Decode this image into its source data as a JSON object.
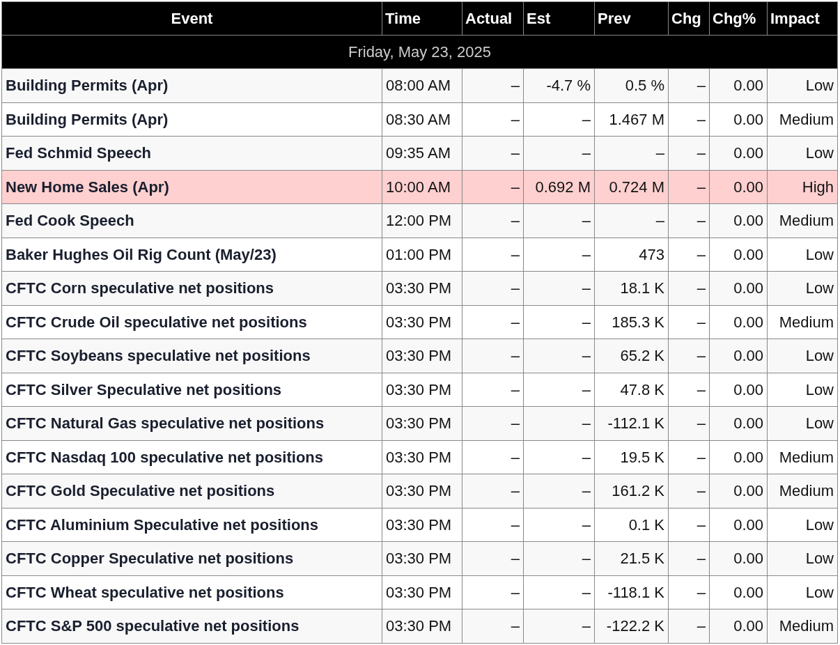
{
  "table": {
    "columns": [
      "Event",
      "Time",
      "Actual",
      "Est",
      "Prev",
      "Chg",
      "Chg%",
      "Impact"
    ],
    "date_row": "Friday, May 23, 2025",
    "rows": [
      {
        "event": "Building Permits (Apr)",
        "time": "08:00 AM",
        "actual": "–",
        "est": "-4.7 %",
        "prev": "0.5 %",
        "chg": "–",
        "chg_pct": "0.00",
        "impact": "Low",
        "highlighted": false
      },
      {
        "event": "Building Permits (Apr)",
        "time": "08:30 AM",
        "actual": "–",
        "est": "–",
        "prev": "1.467 M",
        "chg": "–",
        "chg_pct": "0.00",
        "impact": "Medium",
        "highlighted": false
      },
      {
        "event": "Fed Schmid Speech",
        "time": "09:35 AM",
        "actual": "–",
        "est": "–",
        "prev": "–",
        "chg": "–",
        "chg_pct": "0.00",
        "impact": "Low",
        "highlighted": false
      },
      {
        "event": "New Home Sales (Apr)",
        "time": "10:00 AM",
        "actual": "–",
        "est": "0.692 M",
        "prev": "0.724 M",
        "chg": "–",
        "chg_pct": "0.00",
        "impact": "High",
        "highlighted": true
      },
      {
        "event": "Fed Cook Speech",
        "time": "12:00 PM",
        "actual": "–",
        "est": "–",
        "prev": "–",
        "chg": "–",
        "chg_pct": "0.00",
        "impact": "Medium",
        "highlighted": false
      },
      {
        "event": "Baker Hughes Oil Rig Count (May/23)",
        "time": "01:00 PM",
        "actual": "–",
        "est": "–",
        "prev": "473",
        "chg": "–",
        "chg_pct": "0.00",
        "impact": "Low",
        "highlighted": false
      },
      {
        "event": "CFTC Corn speculative net positions",
        "time": "03:30 PM",
        "actual": "–",
        "est": "–",
        "prev": "18.1 K",
        "chg": "–",
        "chg_pct": "0.00",
        "impact": "Low",
        "highlighted": false
      },
      {
        "event": "CFTC Crude Oil speculative net positions",
        "time": "03:30 PM",
        "actual": "–",
        "est": "–",
        "prev": "185.3 K",
        "chg": "–",
        "chg_pct": "0.00",
        "impact": "Medium",
        "highlighted": false
      },
      {
        "event": "CFTC Soybeans speculative net positions",
        "time": "03:30 PM",
        "actual": "–",
        "est": "–",
        "prev": "65.2 K",
        "chg": "–",
        "chg_pct": "0.00",
        "impact": "Low",
        "highlighted": false
      },
      {
        "event": "CFTC Silver Speculative net positions",
        "time": "03:30 PM",
        "actual": "–",
        "est": "–",
        "prev": "47.8 K",
        "chg": "–",
        "chg_pct": "0.00",
        "impact": "Low",
        "highlighted": false
      },
      {
        "event": "CFTC Natural Gas speculative net positions",
        "time": "03:30 PM",
        "actual": "–",
        "est": "–",
        "prev": "-112.1 K",
        "chg": "–",
        "chg_pct": "0.00",
        "impact": "Low",
        "highlighted": false
      },
      {
        "event": "CFTC Nasdaq 100 speculative net positions",
        "time": "03:30 PM",
        "actual": "–",
        "est": "–",
        "prev": "19.5 K",
        "chg": "–",
        "chg_pct": "0.00",
        "impact": "Medium",
        "highlighted": false
      },
      {
        "event": "CFTC Gold Speculative net positions",
        "time": "03:30 PM",
        "actual": "–",
        "est": "–",
        "prev": "161.2 K",
        "chg": "–",
        "chg_pct": "0.00",
        "impact": "Medium",
        "highlighted": false
      },
      {
        "event": "CFTC Aluminium Speculative net positions",
        "time": "03:30 PM",
        "actual": "–",
        "est": "–",
        "prev": "0.1 K",
        "chg": "–",
        "chg_pct": "0.00",
        "impact": "Low",
        "highlighted": false
      },
      {
        "event": "CFTC Copper Speculative net positions",
        "time": "03:30 PM",
        "actual": "–",
        "est": "–",
        "prev": "21.5 K",
        "chg": "–",
        "chg_pct": "0.00",
        "impact": "Low",
        "highlighted": false
      },
      {
        "event": "CFTC Wheat speculative net positions",
        "time": "03:30 PM",
        "actual": "–",
        "est": "–",
        "prev": "-118.1 K",
        "chg": "–",
        "chg_pct": "0.00",
        "impact": "Low",
        "highlighted": false
      },
      {
        "event": "CFTC S&P 500 speculative net positions",
        "time": "03:30 PM",
        "actual": "–",
        "est": "–",
        "prev": "-122.2 K",
        "chg": "–",
        "chg_pct": "0.00",
        "impact": "Medium",
        "highlighted": false
      }
    ]
  }
}
